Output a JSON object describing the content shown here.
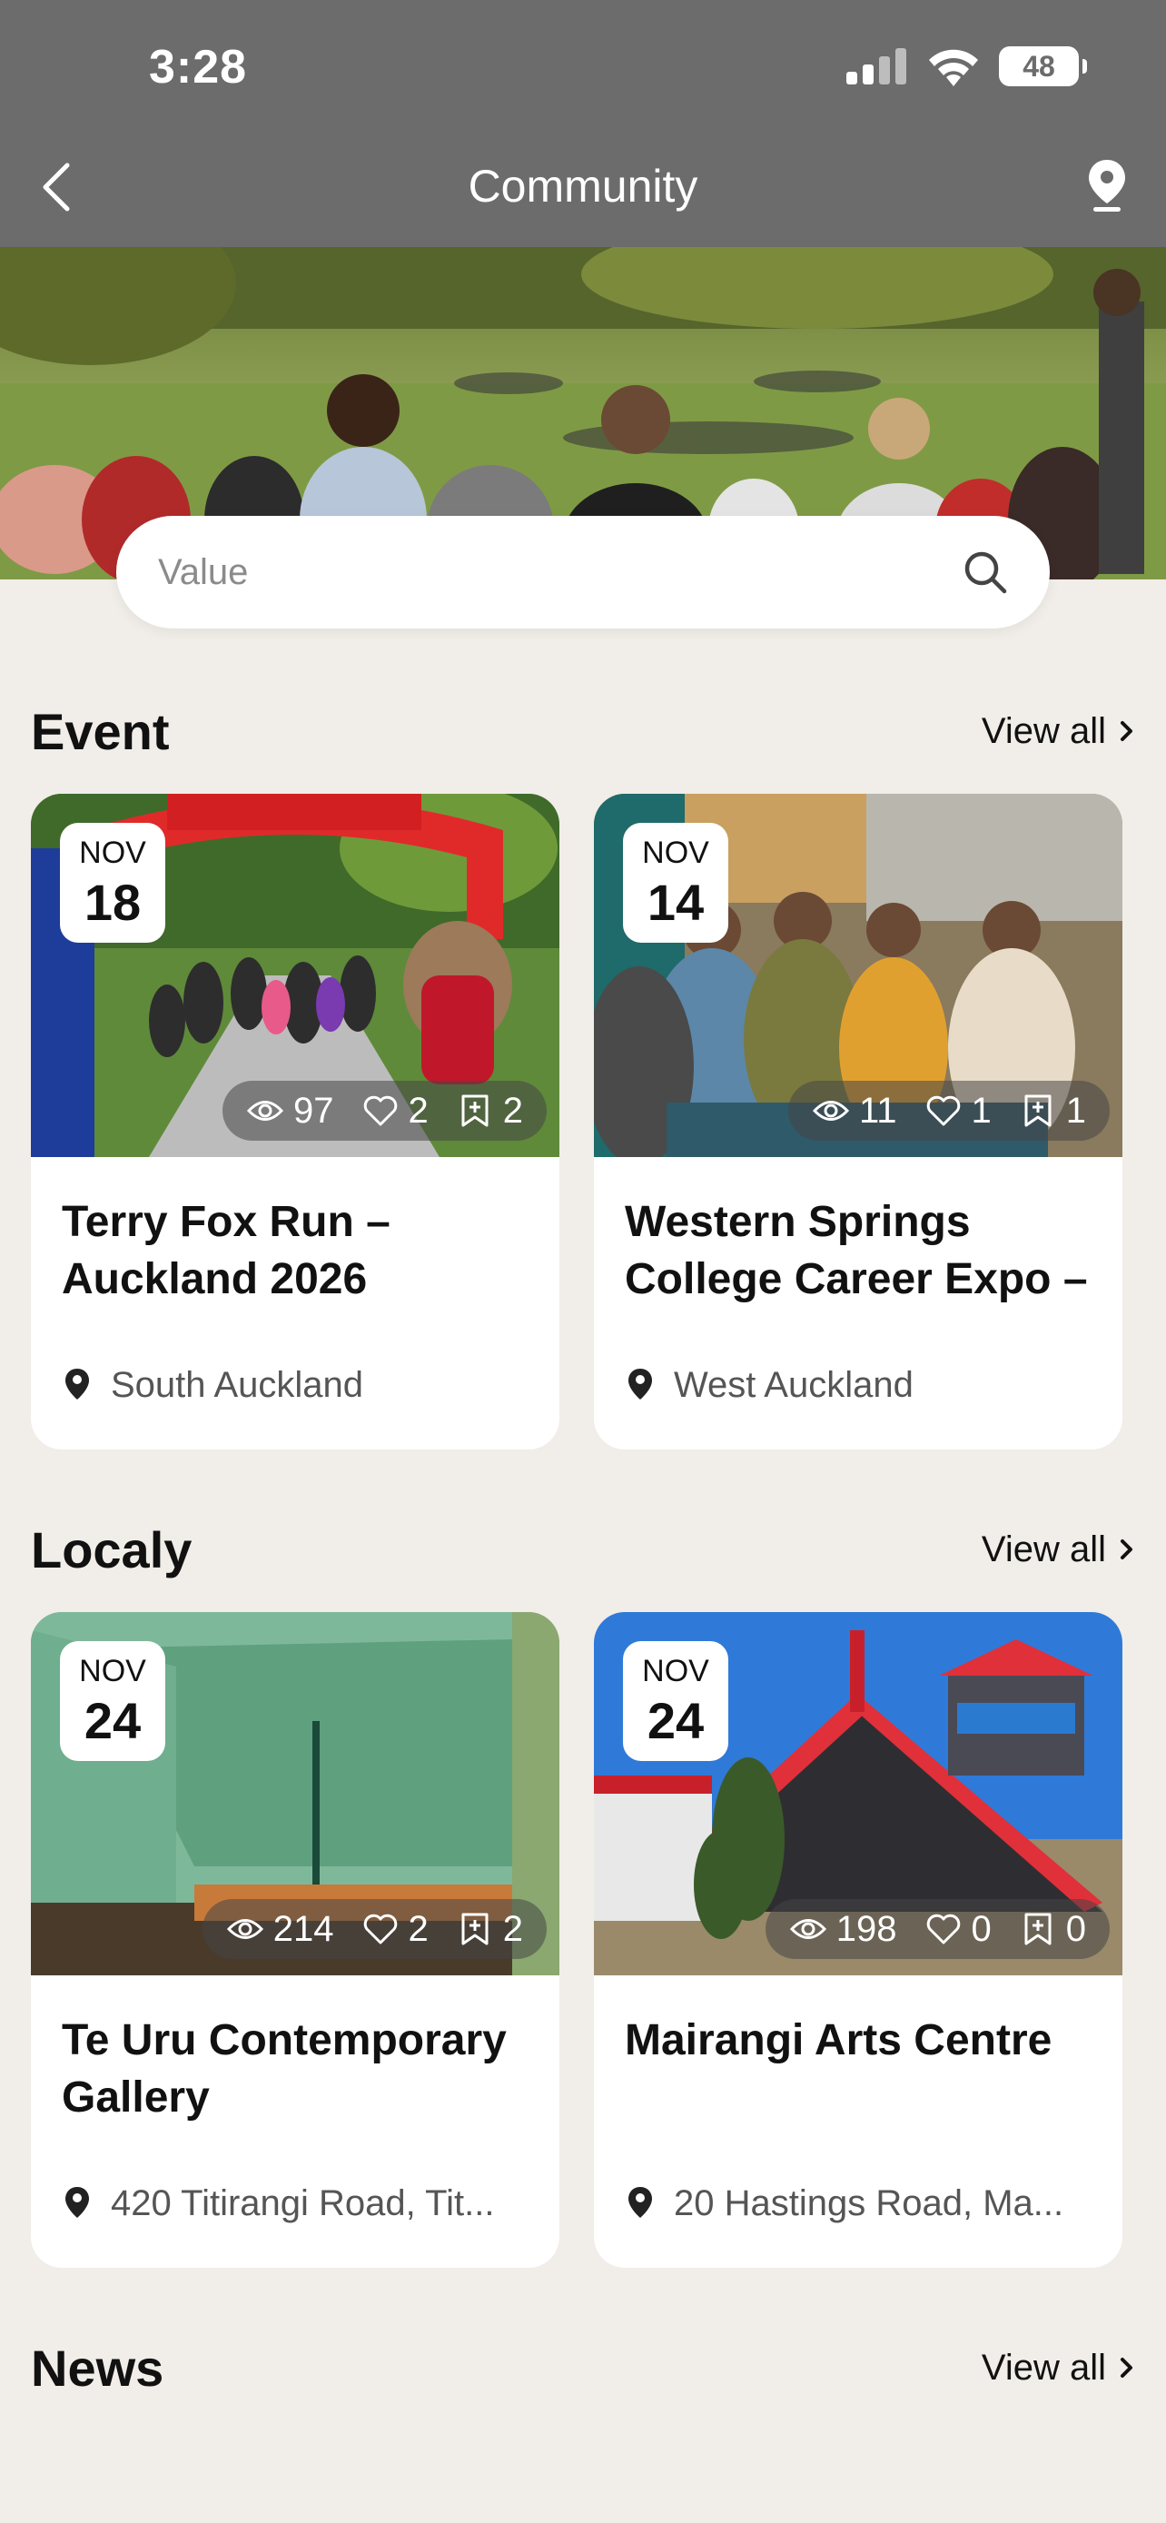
{
  "status_bar": {
    "time": "3:28",
    "battery": "48"
  },
  "nav": {
    "title": "Community"
  },
  "search": {
    "placeholder": "Value"
  },
  "sections": [
    {
      "title": "Event",
      "view_all": "View all",
      "cards": [
        {
          "month": "NOV",
          "day": "18",
          "views": "97",
          "likes": "2",
          "saves": "2",
          "title": "Terry Fox Run – Auckland 2026",
          "location": "South Auckland"
        },
        {
          "month": "NOV",
          "day": "14",
          "views": "11",
          "likes": "1",
          "saves": "1",
          "title": "Western Springs College Career Expo –",
          "location": "West Auckland"
        }
      ]
    },
    {
      "title": "Localy",
      "view_all": "View all",
      "cards": [
        {
          "month": "NOV",
          "day": "24",
          "views": "214",
          "likes": "2",
          "saves": "2",
          "title": "Te Uru Contemporary Gallery",
          "location": "420 Titirangi Road, Tit..."
        },
        {
          "month": "NOV",
          "day": "24",
          "views": "198",
          "likes": "0",
          "saves": "0",
          "title": "Mairangi Arts Centre",
          "location": "20 Hastings Road, Ma..."
        }
      ]
    },
    {
      "title": "News",
      "view_all": "View all"
    }
  ],
  "colors": {
    "header_bg": "#6c6c6c",
    "page_bg": "#f1ede8",
    "card_bg": "#ffffff"
  },
  "icons": {
    "back": "chevron-left-icon",
    "location": "map-pin-icon",
    "search": "search-icon",
    "views": "eye-icon",
    "likes": "heart-icon",
    "saves": "bookmark-plus-icon"
  }
}
